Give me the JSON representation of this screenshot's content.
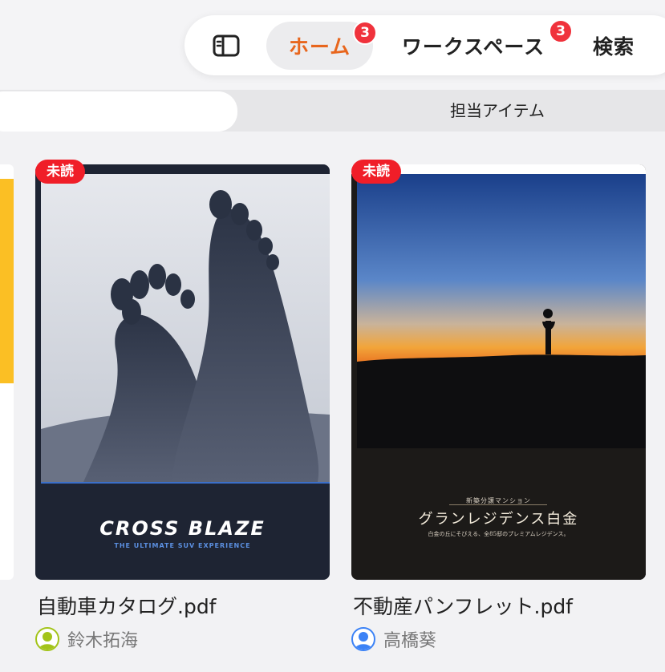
{
  "header": {
    "tabs": {
      "home": {
        "label": "ホーム",
        "badge": "3"
      },
      "workspace": {
        "label": "ワークスペース",
        "badge": "3"
      },
      "search": {
        "label": "検索"
      }
    }
  },
  "subbar": {
    "search_placeholder": "",
    "assigned_label": "担当アイテム"
  },
  "colors": {
    "accent": "#e8661d",
    "badge": "#f0323c",
    "unread": "#f01e28"
  },
  "cards": [
    {
      "unread_label": "未読",
      "filename": "自動車カタログ.pdf",
      "owner": "鈴木拓海",
      "avatar_color": "#a3c41a",
      "cover": {
        "title": "CROSS BLAZE",
        "subtitle": "THE ULTIMATE SUV EXPERIENCE"
      }
    },
    {
      "unread_label": "未読",
      "filename": "不動産パンフレット.pdf",
      "owner": "高橋葵",
      "avatar_color": "#3b82f6",
      "cover": {
        "top_text": "新築分譲マンション",
        "title": "グランレジデンス白金",
        "subtitle": "白金の丘にそびえる、全85邸のプレミアムレジデンス。"
      }
    }
  ]
}
